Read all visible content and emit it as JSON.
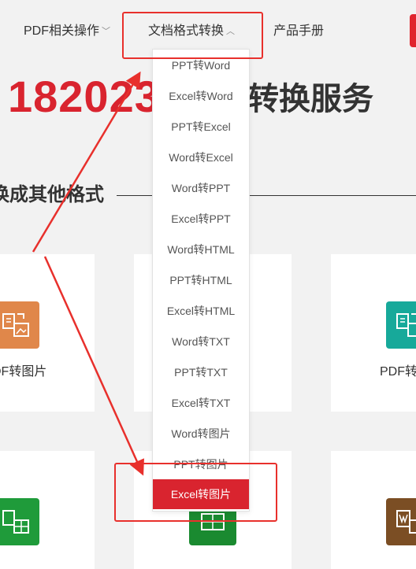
{
  "nav": {
    "items": [
      {
        "label": "PDF相关操作",
        "chevron": "﹀"
      },
      {
        "label": "文档格式转换",
        "chevron": "︿"
      },
      {
        "label": "产品手册"
      }
    ]
  },
  "hero": {
    "number": "182023",
    "suffix": "转换服务"
  },
  "section": {
    "title": "换成其他格式"
  },
  "cards": [
    {
      "label": "DF转图片",
      "icon": "pdf-to-image-icon",
      "color": "#e0874a"
    },
    {
      "label": "PDF转",
      "icon": "pdf-convert-icon",
      "color": "#17a99a"
    },
    {
      "label": "",
      "icon": "excel-document-icon",
      "color": "#1f9b3a"
    },
    {
      "label": "",
      "icon": "excel-convert-icon",
      "color": "#1a8a30"
    },
    {
      "label": "",
      "icon": "word-document-icon",
      "color": "#7b4e24"
    }
  ],
  "dropdown": {
    "items": [
      "PPT转Word",
      "Excel转Word",
      "PPT转Excel",
      "Word转Excel",
      "Word转PPT",
      "Excel转PPT",
      "Word转HTML",
      "PPT转HTML",
      "Excel转HTML",
      "Word转TXT",
      "PPT转TXT",
      "Excel转TXT",
      "Word转图片",
      "PPT转图片",
      "Excel转图片"
    ],
    "active_index": 14
  },
  "colors": {
    "brand_red": "#d9242f",
    "annotation_red": "#e8302c"
  }
}
